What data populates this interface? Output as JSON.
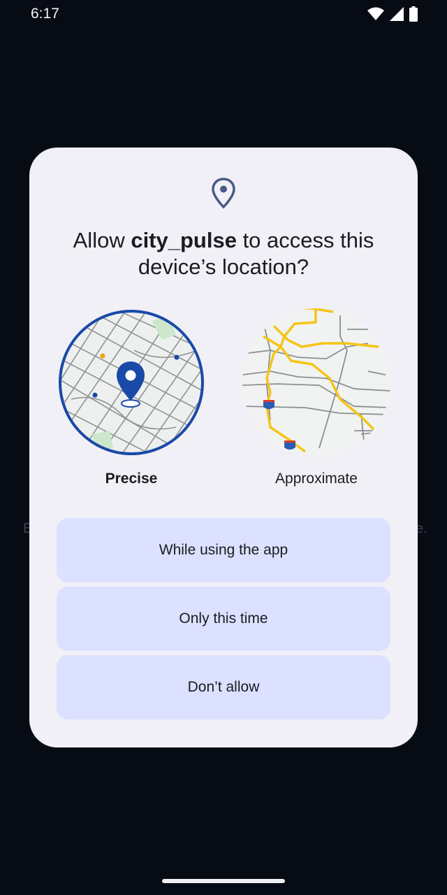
{
  "status_bar": {
    "time": "6:17",
    "icons": [
      "wifi-icon",
      "cellular-signal-icon",
      "battery-icon"
    ]
  },
  "background": {
    "left_fragment": "E",
    "right_fragment": "e."
  },
  "dialog": {
    "title_prefix": "Allow ",
    "app_name": "city_pulse",
    "title_suffix": " to access this device’s location?",
    "icon": "location-pin-icon",
    "options": [
      {
        "label": "Precise",
        "selected": true,
        "icon": "precise-map-icon"
      },
      {
        "label": "Approximate",
        "selected": false,
        "icon": "approximate-map-icon"
      }
    ],
    "buttons": {
      "while_using": "While using the app",
      "only_this_time": "Only this time",
      "dont_allow": "Don’t allow"
    }
  },
  "colors": {
    "screen_background": "#070b14",
    "dialog_background": "#f1f0f7",
    "button_background": "#dce1ff",
    "accent": "#1a4aa8",
    "road_highlight": "#f5c518"
  }
}
